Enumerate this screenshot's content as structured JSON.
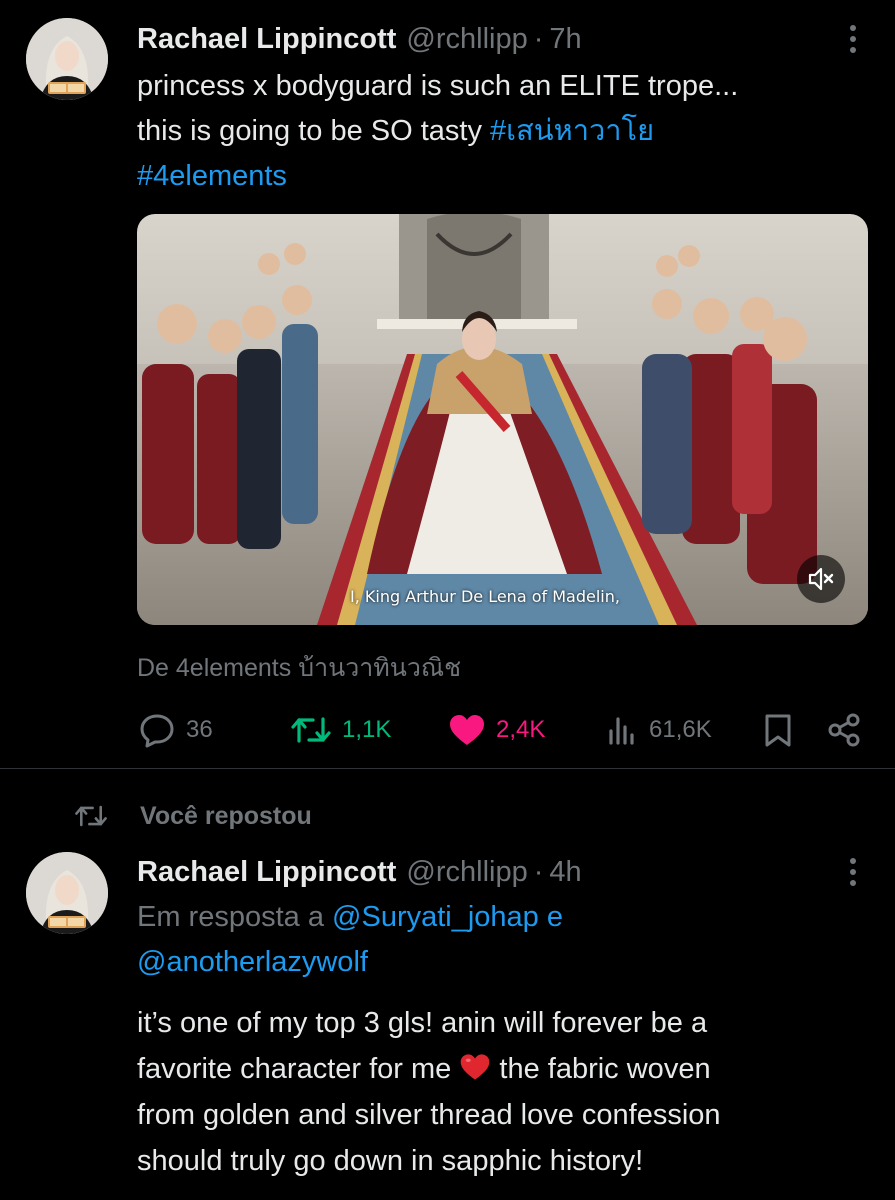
{
  "tweet1": {
    "name": "Rachael Lippincott",
    "handle": "@rchllipp",
    "separator": "·",
    "time": "7h",
    "text_line1": "princess x bodyguard is such an ELITE trope...",
    "text_line2_prefix": "this is going to be SO tasty ",
    "hashtag1": "#เสน่หาวาโย",
    "hashtag2": "#4elements",
    "video_subtitle": "I, King Arthur De Lena of Madelin,",
    "source": "De 4elements บ้านวาทินวณิช",
    "stats": {
      "replies": "36",
      "reposts": "1,1K",
      "likes": "2,4K",
      "views": "61,6K"
    },
    "colors": {
      "repost": "#00ba7c",
      "like": "#f91880",
      "link": "#1d9bf0",
      "muted": "#71767b"
    }
  },
  "repost_indicator": "Você repostou",
  "tweet2": {
    "name": "Rachael Lippincott",
    "handle": "@rchllipp",
    "separator": "·",
    "time": "4h",
    "reply_prefix": "Em resposta a ",
    "reply_user1": "@Suryati_johap",
    "reply_conj": " e",
    "reply_user2": "@anotherlazywolf",
    "body_line1": "it’s one of my top 3 gls! anin will forever be a",
    "body_line2a": "favorite character for me ",
    "body_line2b": " the fabric woven",
    "body_line3": "from golden and silver thread love confession",
    "body_line4": "should truly go down in sapphic history!"
  },
  "icons": [
    "more-icon",
    "reply-icon",
    "repost-icon",
    "heart-icon",
    "views-icon",
    "bookmark-icon",
    "share-icon",
    "mute-icon",
    "heart-emoji-icon"
  ]
}
